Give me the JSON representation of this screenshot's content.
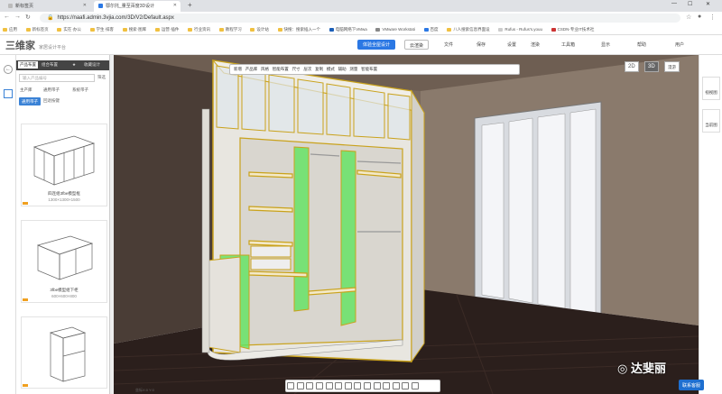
{
  "browser": {
    "tabs": [
      {
        "title": "新标签页",
        "icon": "blank-page-icon",
        "active": false
      },
      {
        "title": "鄂尔托_量至百度3D设计",
        "icon": "site-favicon-icon",
        "active": true
      }
    ],
    "new_tab": "+",
    "window_controls": {
      "minimize": "—",
      "maximize": "☐",
      "close": "✕"
    },
    "url": "https://naafi.admin.3vjia.com/3D/V2/Default.aspx",
    "bookmarks": [
      "应用",
      "新标签页",
      "实在·办公",
      "学生·排客",
      "搜索·图库",
      "运营·插件",
      "行业资讯",
      "教程学习",
      "设计站",
      "快搜：搜索插入一个",
      "电脑网络下VMwa",
      "VMware Workstati",
      "百度",
      "八人搜索信息界面设",
      "Rufus - Rufus's.youu",
      "CSDN-专业IT技术社"
    ]
  },
  "app": {
    "logo": "三维家",
    "logo_sub": "家居设计平台",
    "primary_button": "体验全屋设计",
    "secondary_button": "云渲染",
    "menus": [
      "文件",
      "保存",
      "设置",
      "渲染",
      "工具箱",
      "显示",
      "帮助",
      "用户"
    ]
  },
  "left_panel": {
    "tabs": [
      "产品布置",
      "组合布置",
      "收藏设计"
    ],
    "search_placeholder": "输入产品编号",
    "search_side": "筛选",
    "breadcrumb_left": "主产库",
    "breadcrumb_mid": "通用带子",
    "breadcrumb_right": "系统带子",
    "chip_active": "通用带子",
    "chip_other": "回退按键",
    "cards": [
      {
        "name": "四连组3fbe模型框",
        "size": "1300×1300×1500"
      },
      {
        "name": "3fbe模型组下柜",
        "size": "600×600×800"
      },
      {
        "name": "",
        "size": ""
      }
    ]
  },
  "viewport": {
    "toolbar": [
      "新增",
      "产品库",
      "风格",
      "智能布置",
      "尺寸",
      "层次",
      "复制",
      "模式",
      "辅助",
      "测量",
      "智能布置"
    ],
    "mode_2d": "2D",
    "mode_3d": "3D",
    "mode_roam": "漫游",
    "right_buttons": [
      "视视图",
      "当前图"
    ],
    "coordinate_text": "坐标X:0 Y:0"
  },
  "watermark": "达斐丽",
  "bottom_right_button": "联系客服",
  "colors": {
    "accent_blue": "#2b78e4",
    "cabinet_frame": "#e0b020",
    "cabinet_green": "#60e060",
    "floor": "#2a1d1a",
    "wall": "#6a5a4d"
  }
}
